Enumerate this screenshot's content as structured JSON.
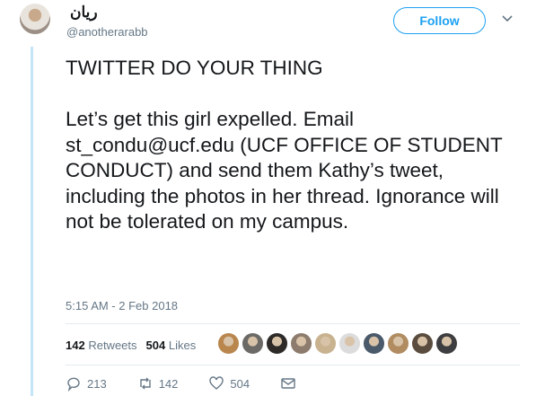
{
  "tweet": {
    "display_name": "ريان",
    "handle": "@anotherarabb",
    "text": "TWITTER DO YOUR THING\n\nLet’s get this girl expelled. Email st_condu@ucf.edu (UCF OFFICE OF STUDENT CONDUCT) and send them Kathy’s tweet, including the photos in her thread. Ignorance will not be tolerated on my campus.",
    "timestamp": "5:15 AM - 2 Feb 2018"
  },
  "follow_label": "Follow",
  "stats": {
    "retweets_count": "142",
    "retweets_label": "Retweets",
    "likes_count": "504",
    "likes_label": "Likes"
  },
  "liker_avatar_colors": [
    "#b9874e",
    "#6c6a66",
    "#2d2a28",
    "#8d7c6d",
    "#c8b28f",
    "#dcdcdc",
    "#4a5a6a",
    "#b08c60",
    "#5a4c3e",
    "#3e3e40"
  ],
  "actions": {
    "reply_count": "213",
    "retweet_count": "142",
    "like_count": "504"
  },
  "icons": [
    "chevron-down-icon",
    "reply-icon",
    "retweet-icon",
    "heart-icon",
    "envelope-icon"
  ],
  "colors": {
    "accent": "#1da1f2",
    "muted": "#657786",
    "thread_line": "#c4e4f7"
  }
}
